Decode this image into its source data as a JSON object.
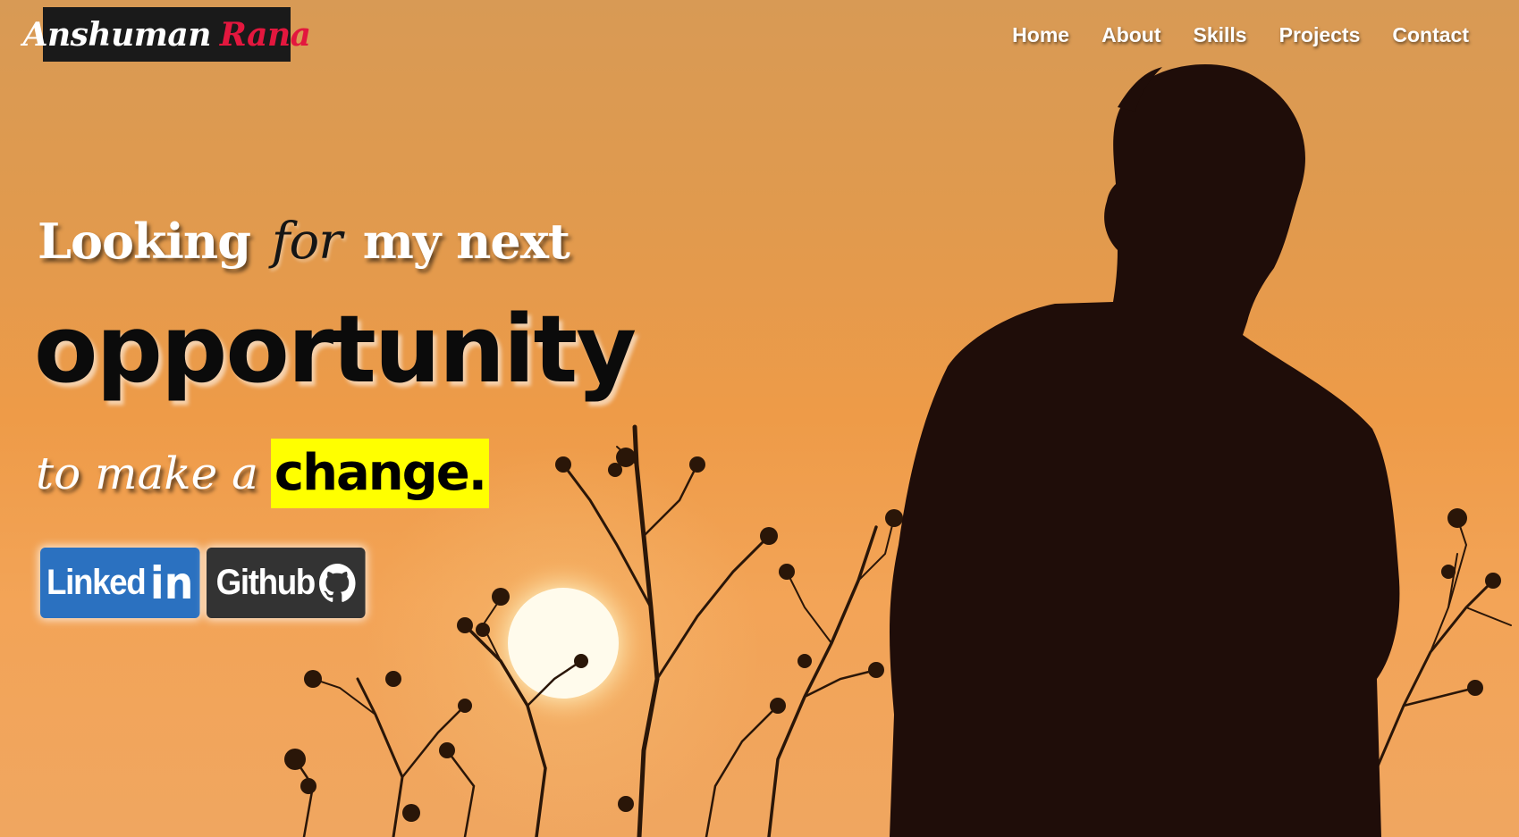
{
  "logo": {
    "first_name": "Anshuman",
    "last_name": "Rana"
  },
  "nav": {
    "items": [
      {
        "label": "Home"
      },
      {
        "label": "About"
      },
      {
        "label": "Skills"
      },
      {
        "label": "Projects"
      },
      {
        "label": "Contact"
      }
    ]
  },
  "hero": {
    "line1_before": "Looking",
    "line1_script": "for",
    "line1_after": "my next",
    "line2": "opportunity",
    "line3_lead": "to make a",
    "line3_highlight": "change."
  },
  "buttons": {
    "linkedin_label": "Linked",
    "linkedin_icon_text": "in",
    "github_label": "Github"
  },
  "icons": {
    "linkedin": "linkedin-logo-icon",
    "github": "github-octocat-icon"
  },
  "colors": {
    "logo_bg": "#1a1a1a",
    "logo_accent": "#e3173e",
    "highlight": "#ffff00",
    "linkedin_blue": "#2b71c0",
    "github_dark": "#333333"
  }
}
